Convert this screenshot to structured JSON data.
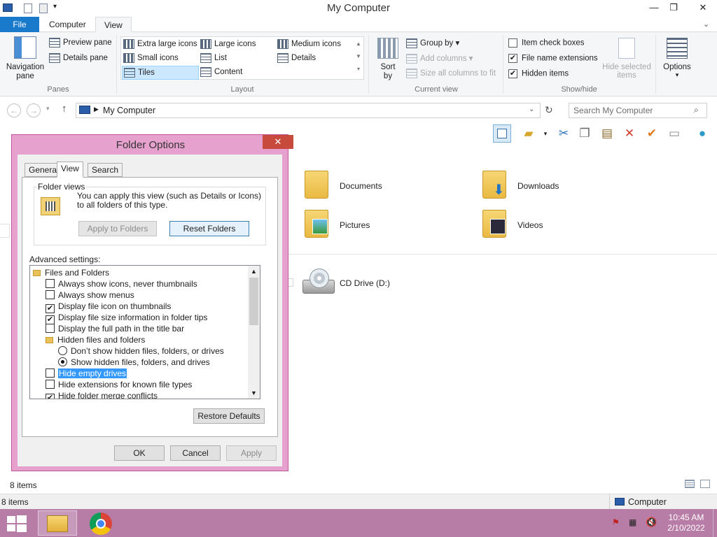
{
  "window": {
    "title": "My Computer"
  },
  "ribbon": {
    "tabs": [
      "File",
      "Computer",
      "View"
    ],
    "panes": {
      "navigation_pane": "Navigation pane",
      "preview_pane": "Preview pane",
      "details_pane": "Details pane",
      "label": "Panes"
    },
    "layout": {
      "items": [
        "Extra large icons",
        "Large icons",
        "Medium icons",
        "Small icons",
        "List",
        "Details",
        "Tiles",
        "Content"
      ],
      "label": "Layout"
    },
    "current_view": {
      "sort_by": "Sort by",
      "group_by": "Group by",
      "add_columns": "Add columns",
      "size_columns": "Size all columns to fit",
      "label": "Current view"
    },
    "show_hide": {
      "item_check_boxes": "Item check boxes",
      "file_name_extensions": "File name extensions",
      "hidden_items": "Hidden items",
      "hide_selected": "Hide selected items",
      "label": "Show/hide"
    },
    "options": "Options"
  },
  "address": {
    "path": "My Computer",
    "search_placeholder": "Search My Computer"
  },
  "content": {
    "folders": [
      "Documents",
      "Downloads",
      "Pictures",
      "Videos"
    ],
    "drives": [
      "CD Drive (D:)"
    ]
  },
  "dialog": {
    "title": "Folder Options",
    "tabs": [
      "General",
      "View",
      "Search"
    ],
    "folder_views": {
      "heading": "Folder views",
      "text": "You can apply this view (such as Details or Icons) to all folders of this type.",
      "apply": "Apply to Folders",
      "reset": "Reset Folders"
    },
    "advanced_label": "Advanced settings:",
    "advanced": {
      "r0": "Files and Folders",
      "r1": "Always show icons, never thumbnails",
      "r2": "Always show menus",
      "r3": "Display file icon on thumbnails",
      "r4": "Display file size information in folder tips",
      "r5": "Display the full path in the title bar",
      "r6": "Hidden files and folders",
      "r7": "Don’t show hidden files, folders, or drives",
      "r8": "Show hidden files, folders, and drives",
      "r9": "Hide empty drives",
      "r10": "Hide extensions for known file types",
      "r11": "Hide folder merge conflicts"
    },
    "restore": "Restore Defaults",
    "ok": "OK",
    "cancel": "Cancel",
    "apply": "Apply"
  },
  "status": {
    "items_count": "8 items",
    "items_count_bottom": "8 items",
    "location": "Computer"
  },
  "taskbar": {
    "time": "10:45 AM",
    "date": "2/10/2022"
  },
  "colors": {
    "accent": "#1979ca",
    "dialog_border": "#e7a1cf",
    "taskbar": "#b87da7",
    "selection": "#3399ff"
  }
}
